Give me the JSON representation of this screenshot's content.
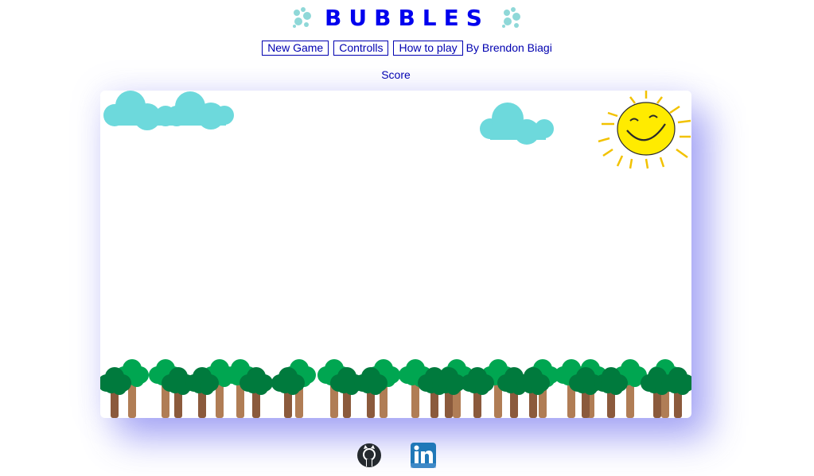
{
  "header": {
    "title": "BUBBLES",
    "left_icon": "bubbles-icon",
    "right_icon": "bubbles-icon"
  },
  "nav": {
    "new_game_label": "New Game",
    "controls_label": "Controlls",
    "how_to_play_label": "How to play",
    "author_text": "By Brendon Biagi"
  },
  "score": {
    "label": "Score"
  },
  "scene": {
    "sky_color": "#ffffff",
    "cloud_color": "#6dd9dc",
    "sun_color": "#ffeb00",
    "foliage_dark": "#007a3d",
    "foliage_light": "#00a651",
    "trunk_dark": "#8b5a3c",
    "trunk_light": "#b07d55"
  },
  "footer": {
    "github_icon": "github-icon",
    "linkedin_icon": "linkedin-icon"
  },
  "colors": {
    "link_blue": "#0000ee",
    "board_shadow": "#5a5ae8"
  }
}
